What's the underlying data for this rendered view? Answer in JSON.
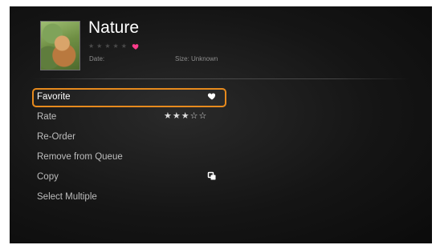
{
  "header": {
    "title": "Nature",
    "rating_stars": [
      "★",
      "★",
      "★",
      "★",
      "★"
    ],
    "date_label": "Date:",
    "size_label": "Size: Unknown",
    "favorite_color": "#ff3c8c"
  },
  "menu": {
    "items": [
      {
        "label": "Favorite",
        "icon": "heart-icon",
        "focused": true
      },
      {
        "label": "Rate",
        "stars": "★★★☆☆",
        "rating": 3,
        "max": 5
      },
      {
        "label": "Re-Order"
      },
      {
        "label": "Remove from Queue"
      },
      {
        "label": "Copy",
        "icon": "copy-icon"
      },
      {
        "label": "Select Multiple"
      }
    ]
  },
  "colors": {
    "focus_border": "#e78a1d",
    "background": "#151515",
    "text": "#bdbdbd"
  }
}
